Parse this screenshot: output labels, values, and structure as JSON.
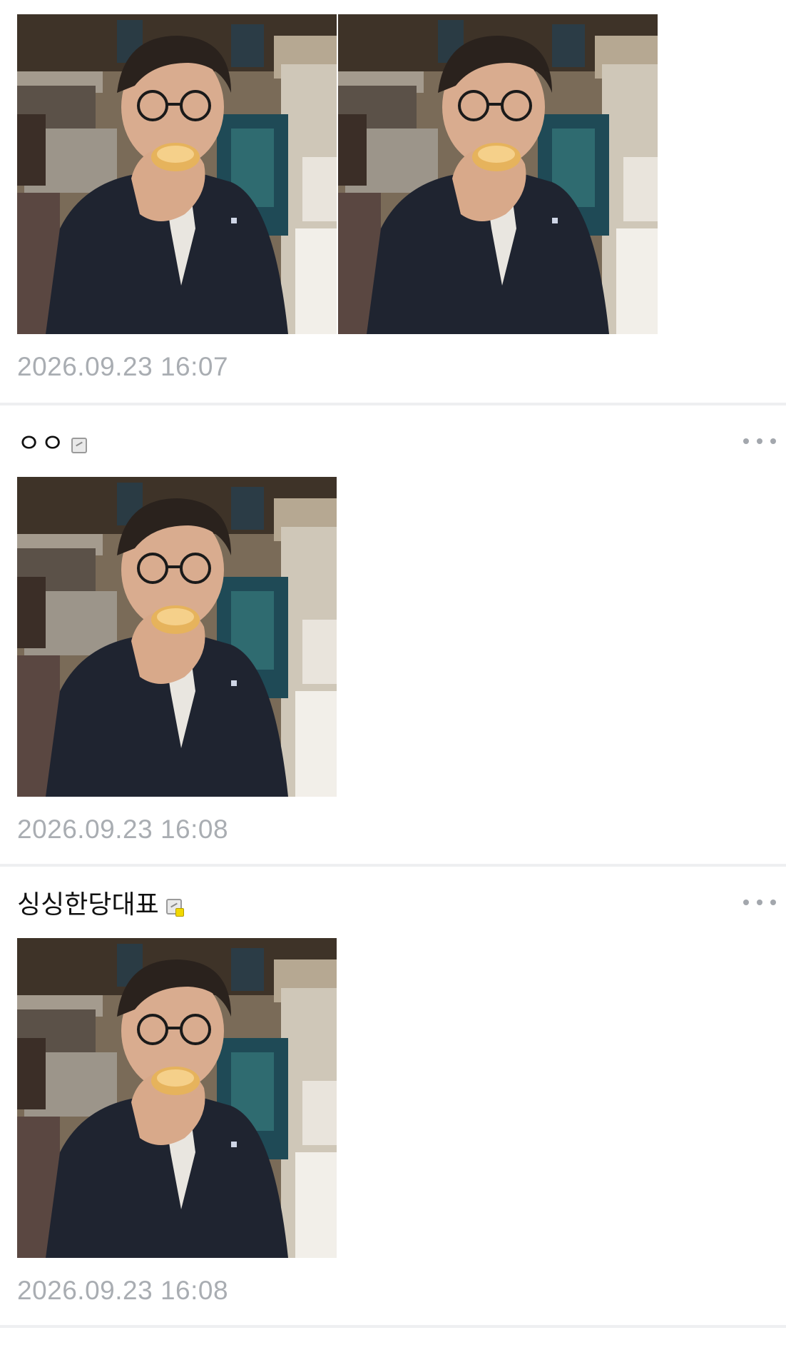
{
  "comments": [
    {
      "author": "",
      "photos": [
        "gif-frame",
        "gif-frame"
      ],
      "timestamp": "2026.09.23 16:07"
    },
    {
      "author": "ㅇㅇ",
      "badge_icon": "edit-badge-icon",
      "more_icon": "more-options-icon",
      "photos": [
        "gif-frame"
      ],
      "timestamp": "2026.09.23 16:08"
    },
    {
      "author": "싱싱한당대표",
      "badge_icon": "edit-badge-gold-icon",
      "more_icon": "more-options-icon",
      "photos": [
        "gif-frame"
      ],
      "timestamp": "2026.09.23 16:08"
    }
  ],
  "colors": {
    "timestamp": "#a9adb2",
    "divider": "#eeeff1",
    "more_dots": "#a3a7ad"
  }
}
